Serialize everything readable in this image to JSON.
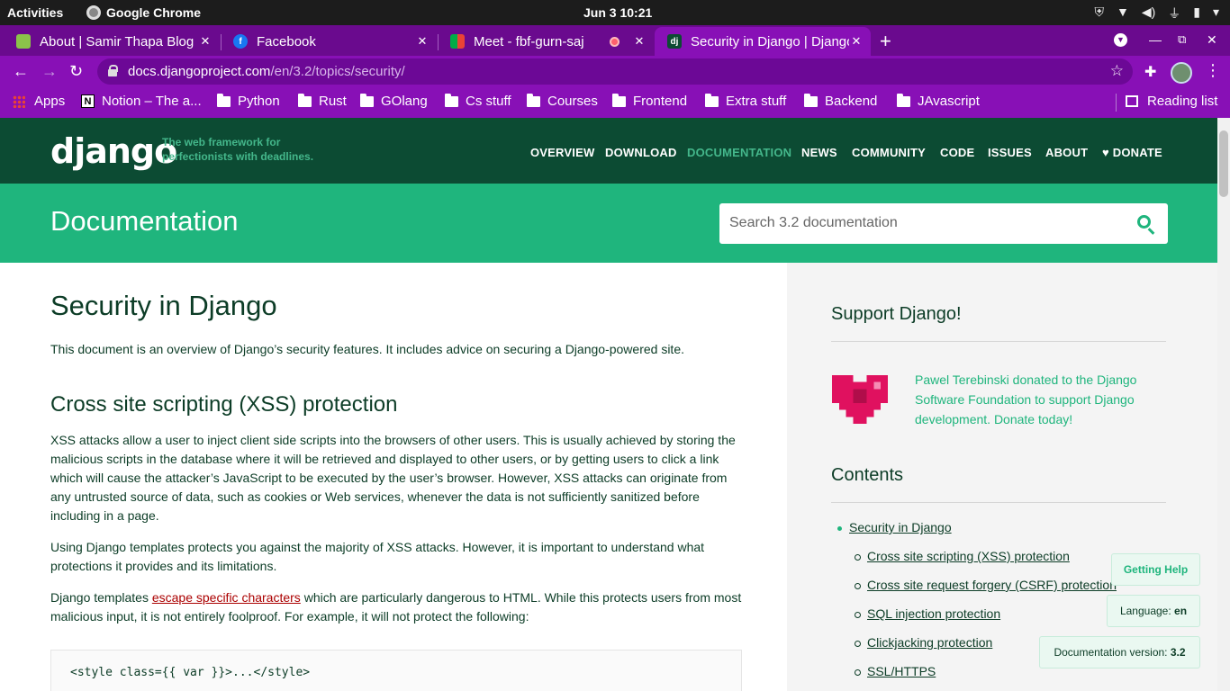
{
  "os_bar": {
    "activities": "Activities",
    "app_name": "Google Chrome",
    "clock": "Jun 3  10:21"
  },
  "tabs": [
    {
      "title": "About | Samir Thapa Blog",
      "favicon": "blog-icon",
      "color": "#8bc34a"
    },
    {
      "title": "Facebook",
      "favicon": "facebook-icon",
      "color": "#1877f2"
    },
    {
      "title": "Meet - fbf-gurn-saj",
      "favicon": "meet-icon",
      "color": "#00ac47"
    },
    {
      "title": "Security in Django | Django documentation",
      "favicon": "django-icon",
      "color": "#0c4b33"
    }
  ],
  "address_bar": {
    "host": "docs.djangoproject.com",
    "path": "/en/3.2/topics/security/"
  },
  "bookmarks": {
    "apps": "Apps",
    "notion": "Notion – The a...",
    "folders": [
      "Python",
      "Rust",
      "GOlang",
      "Cs stuff",
      "Courses",
      "Frontend",
      "Extra stuff",
      "Backend",
      "JAvascript"
    ],
    "reading_list": "Reading list"
  },
  "django_header": {
    "logo": "django",
    "tagline_line1": "The web framework for",
    "tagline_line2": "perfectionists with deadlines.",
    "nav": [
      "OVERVIEW",
      "DOWNLOAD",
      "DOCUMENTATION",
      "NEWS",
      "COMMUNITY",
      "CODE",
      "ISSUES",
      "ABOUT",
      "♥ DONATE"
    ],
    "active_nav": "DOCUMENTATION"
  },
  "doc_band": {
    "title": "Documentation",
    "search_placeholder": "Search 3.2 documentation"
  },
  "article": {
    "title": "Security in Django",
    "intro": "This document is an overview of Django’s security features. It includes advice on securing a Django-powered site.",
    "section_title": "Cross site scripting (XSS) protection",
    "para1": "XSS attacks allow a user to inject client side scripts into the browsers of other users. This is usually achieved by storing the malicious scripts in the database where it will be retrieved and displayed to other users, or by getting users to click a link which will cause the attacker’s JavaScript to be executed by the user’s browser. However, XSS attacks can originate from any untrusted source of data, such as cookies or Web services, whenever the data is not sufficiently sanitized before including in a page.",
    "para2": "Using Django templates protects you against the majority of XSS attacks. However, it is important to understand what protections it provides and its limitations.",
    "para3_before": "Django templates ",
    "para3_link": "escape specific characters",
    "para3_after": " which are particularly dangerous to HTML. While this protects users from most malicious input, it is not entirely foolproof. For example, it will not protect the following:",
    "code": "<style class={{ var }}>...</style>"
  },
  "sidebar": {
    "support_title": "Support Django!",
    "donation_text": "Pawel Terebinski donated to the Django Software Foundation to support Django development. Donate today!",
    "contents_title": "Contents",
    "toc_root": "Security in Django",
    "toc_items": [
      "Cross site scripting (XSS) protection",
      "Cross site request forgery (CSRF) protection",
      "SQL injection protection",
      "Clickjacking protection",
      "SSL/HTTPS"
    ]
  },
  "floating": {
    "getting_help": "Getting Help",
    "language_label": "Language:",
    "language_value": "en",
    "version_label": "Documentation version:",
    "version_value": "3.2"
  }
}
